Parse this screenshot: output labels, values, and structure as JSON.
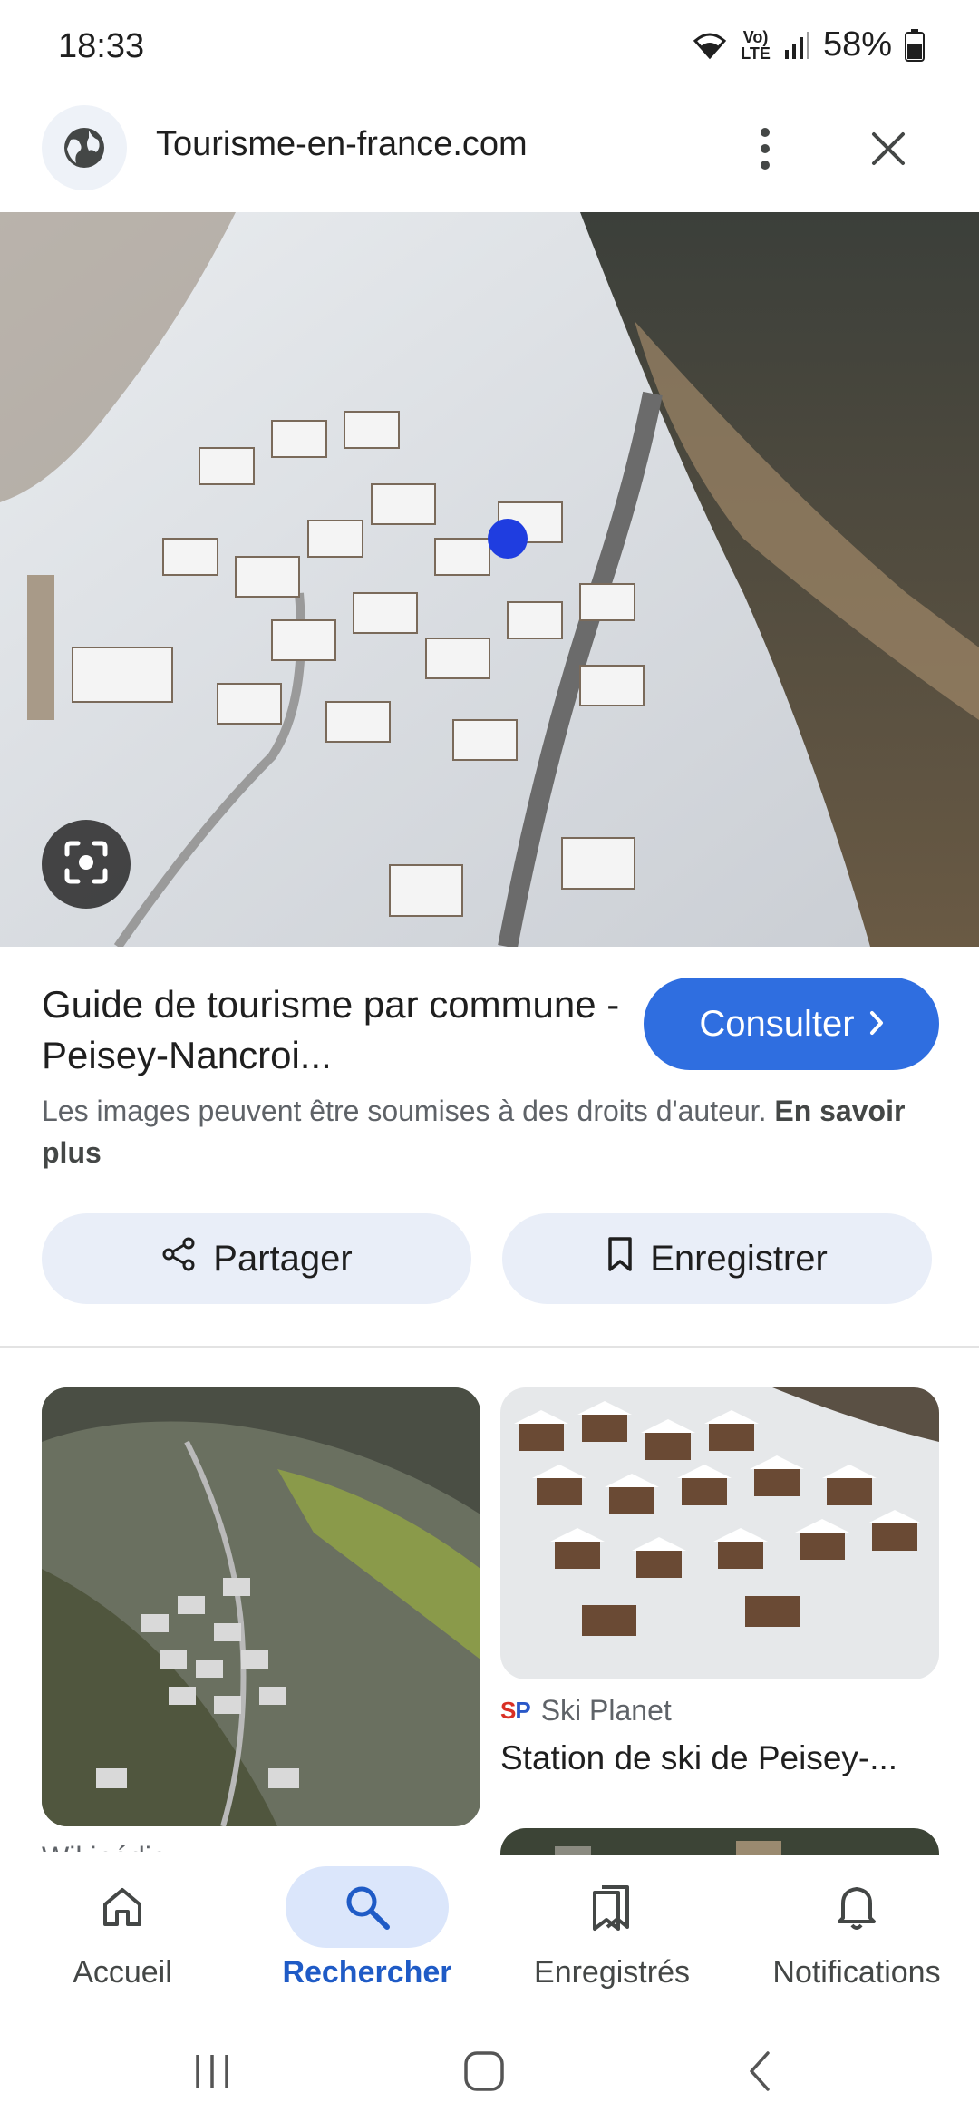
{
  "status_bar": {
    "time": "18:33",
    "battery": "58%",
    "network_label": "LTE",
    "icons": [
      "wifi-icon",
      "volte-icon",
      "signal-icon",
      "battery-icon"
    ]
  },
  "header": {
    "site_title": "Tourisme-en-france.com",
    "icons": [
      "globe-icon",
      "more-vert-icon",
      "close-icon"
    ]
  },
  "result": {
    "title": "Guide de tourisme par commune - Peisey-Nancroi...",
    "consult_label": "Consulter",
    "copyright_text": "Les images peuvent être soumises à des droits d'auteur.",
    "learn_more_label": "En savoir plus"
  },
  "actions": {
    "share_label": "Partager",
    "save_label": "Enregistrer"
  },
  "related": {
    "items": [
      {
        "source": "Wikipédia",
        "title": ""
      },
      {
        "source": "Ski Planet",
        "title": "Station de ski de Peisey-..."
      }
    ]
  },
  "bottom_nav": {
    "items": [
      {
        "label": "Accueil",
        "icon": "home-icon"
      },
      {
        "label": "Rechercher",
        "icon": "search-icon",
        "active": true
      },
      {
        "label": "Enregistrés",
        "icon": "saved-icon"
      },
      {
        "label": "Notifications",
        "icon": "bell-icon"
      }
    ]
  },
  "colors": {
    "accent": "#2f6ee0",
    "active_nav": "#1f5bc6",
    "chip_bg": "#e9eef8"
  }
}
